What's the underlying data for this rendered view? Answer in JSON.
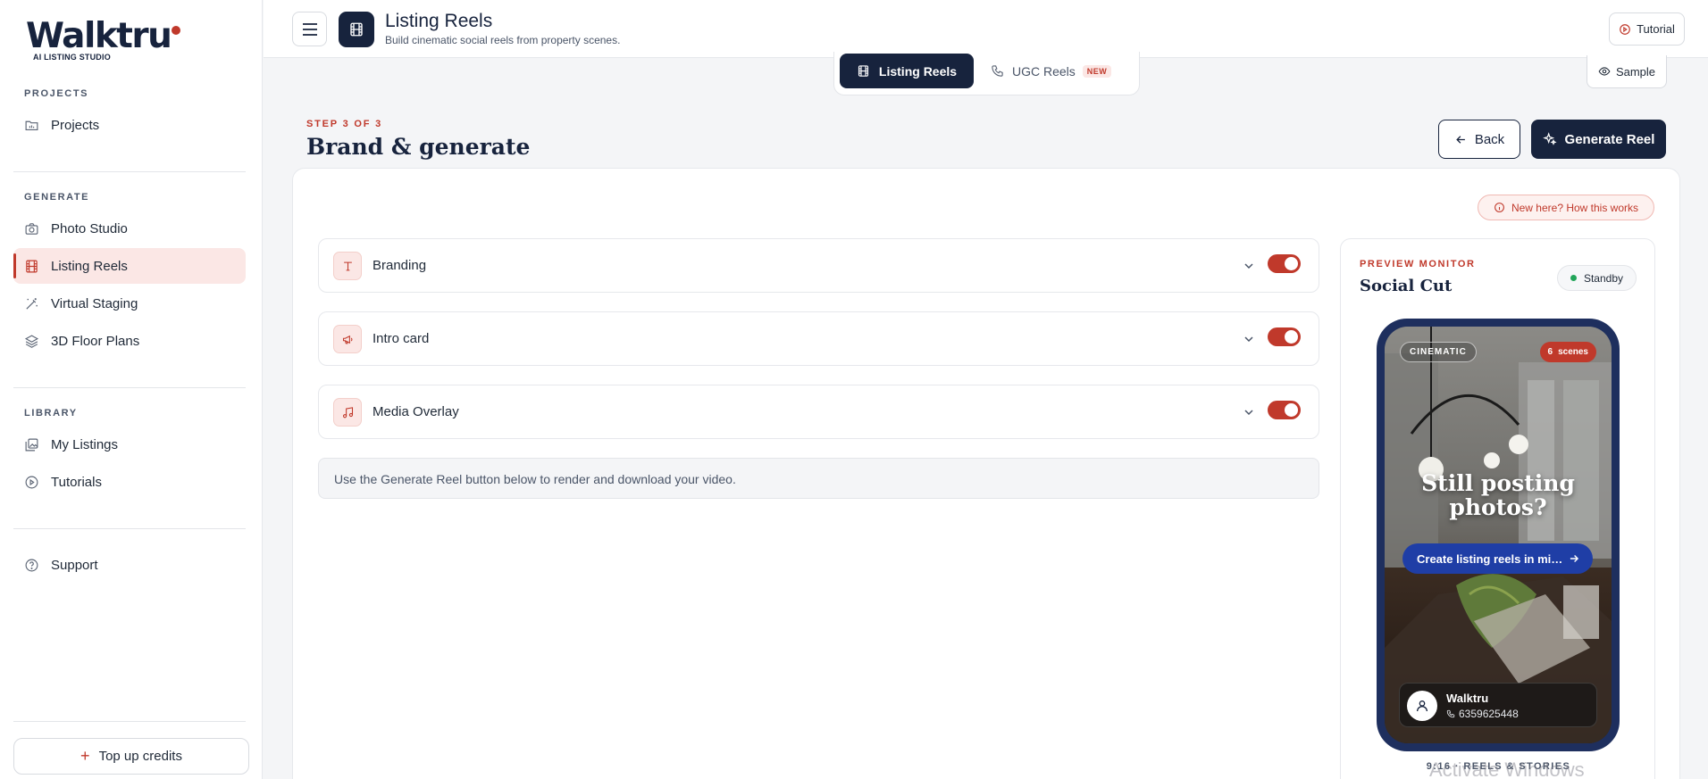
{
  "brand": {
    "name": "Walktru",
    "tagline": "AI LISTING STUDIO",
    "accent": "#c0392b",
    "navy": "#17233d"
  },
  "sidebar": {
    "sections": [
      {
        "label": "PROJECTS",
        "items": [
          {
            "label": "Projects",
            "icon": "folder-icon"
          }
        ]
      },
      {
        "label": "GENERATE",
        "items": [
          {
            "label": "Photo Studio",
            "icon": "camera-icon"
          },
          {
            "label": "Listing Reels",
            "icon": "film-icon",
            "active": true
          },
          {
            "label": "Virtual Staging",
            "icon": "magic-wand-icon"
          },
          {
            "label": "3D Floor Plans",
            "icon": "layers-icon"
          }
        ]
      },
      {
        "label": "LIBRARY",
        "items": [
          {
            "label": "My Listings",
            "icon": "gallery-icon"
          },
          {
            "label": "Tutorials",
            "icon": "play-circle-icon"
          }
        ]
      }
    ],
    "support": "Support",
    "topup": "Top up credits"
  },
  "header": {
    "title": "Listing Reels",
    "subtitle": "Build cinematic social reels from property scenes.",
    "tutorial": "Tutorial"
  },
  "mode_tabs": {
    "active": "Listing Reels",
    "other": "UGC Reels",
    "badge": "NEW"
  },
  "sample": "Sample",
  "step": {
    "label": "STEP 3 OF 3",
    "title": "Brand & generate",
    "back": "Back",
    "generate": "Generate Reel"
  },
  "help_chip": "New here? How this works",
  "rows": [
    {
      "label": "Branding",
      "icon": "text-icon",
      "enabled": true
    },
    {
      "label": "Intro card",
      "icon": "megaphone-icon",
      "enabled": true
    },
    {
      "label": "Media Overlay",
      "icon": "music-icon",
      "enabled": true
    }
  ],
  "note": "Use the Generate Reel button below to render and download your video.",
  "preview": {
    "label": "PREVIEW MONITOR",
    "title": "Social Cut",
    "status": "Standby",
    "style_chip": "CINEMATIC",
    "scene_count": "6",
    "scene_word": "scenes",
    "headline_1": "Still posting",
    "headline_2": "photos?",
    "cta": "Create listing reels in minutes",
    "agent_name": "Walktru",
    "agent_phone": "6359625448",
    "footer": "9:16 · REELS & STORIES"
  },
  "watermark": "Activate Windows"
}
